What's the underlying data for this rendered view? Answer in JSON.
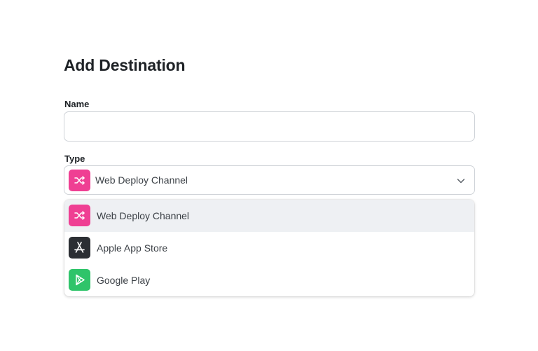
{
  "form": {
    "title": "Add Destination",
    "name_label": "Name",
    "name_value": "",
    "type_label": "Type"
  },
  "select": {
    "selected_label": "Web Deploy Channel",
    "selected_icon": "shuffle-icon"
  },
  "options": [
    {
      "label": "Web Deploy Channel",
      "icon": "shuffle-icon",
      "color": "#ef3f93",
      "highlighted": true
    },
    {
      "label": "Apple App Store",
      "icon": "app-store-icon",
      "color": "#2b2e33",
      "highlighted": false
    },
    {
      "label": "Google Play",
      "icon": "play-icon",
      "color": "#2fc46a",
      "highlighted": false
    }
  ],
  "colors": {
    "highlight_bg": "#eef0f3",
    "border": "#cfd3d8"
  }
}
